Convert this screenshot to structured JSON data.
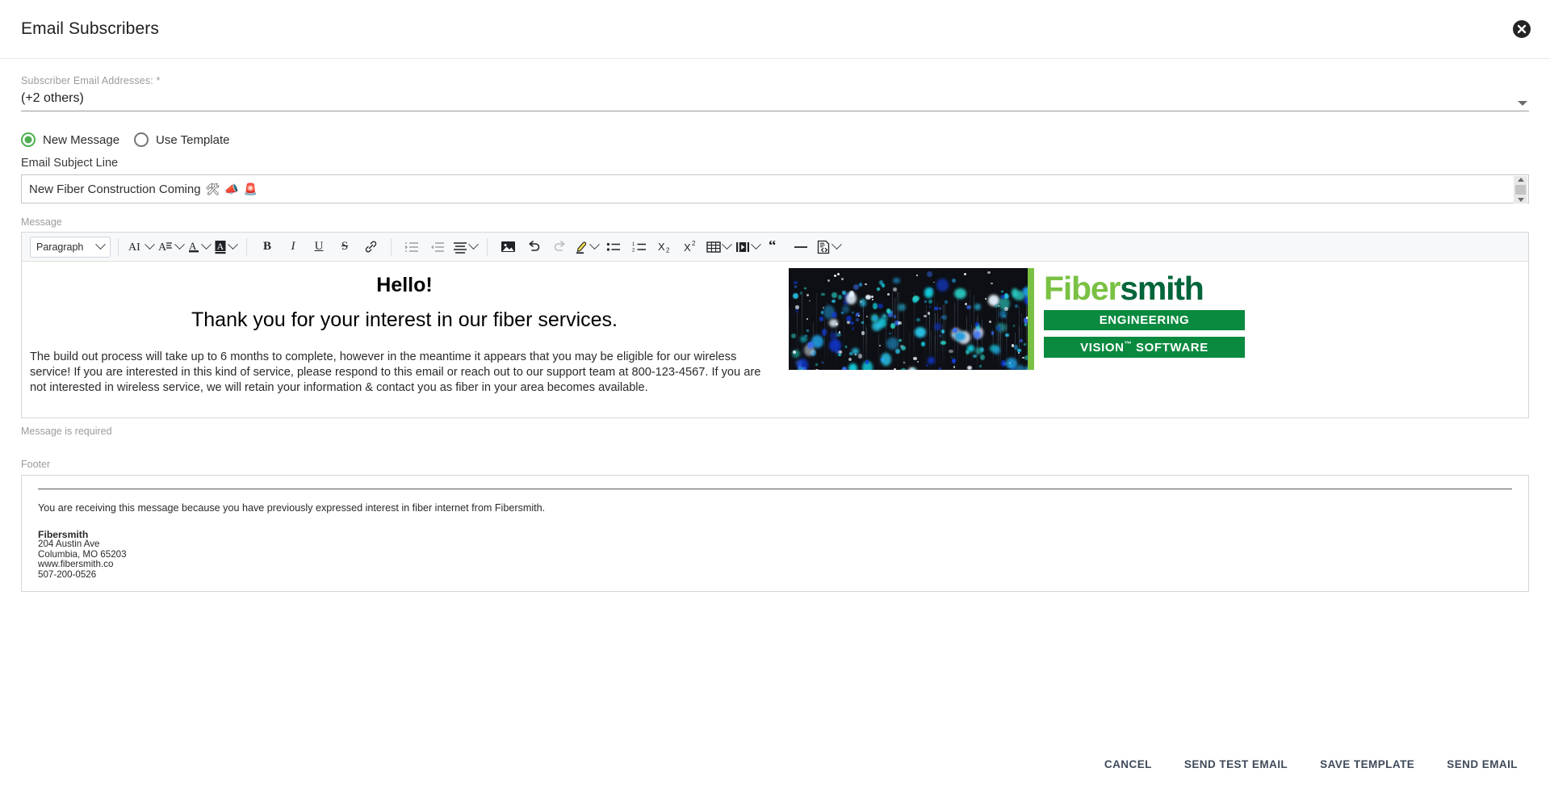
{
  "dialog": {
    "title": "Email Subscribers",
    "close_icon": "close-circle-icon"
  },
  "subscribers": {
    "label": "Subscriber Email Addresses: *",
    "value": "(+2 others)",
    "dropdown_icon": "chevron-down-icon"
  },
  "mode": {
    "options": [
      {
        "label": "New Message",
        "selected": true
      },
      {
        "label": "Use Template",
        "selected": false
      }
    ]
  },
  "subject": {
    "label": "Email Subject Line",
    "value": "New Fiber Construction Coming",
    "emojis": [
      "🛠",
      "📣",
      "🚨"
    ]
  },
  "message": {
    "label": "Message",
    "error": "Message is required",
    "toolbar": {
      "block_format": "Paragraph",
      "items": [
        {
          "name": "font-family-icon",
          "glyph": "AI",
          "caret": true
        },
        {
          "name": "font-size-icon",
          "glyph": "A≡",
          "caret": true
        },
        {
          "name": "text-color-icon",
          "glyph": "A",
          "caret": true
        },
        {
          "name": "background-color-icon",
          "glyph": "A",
          "caret": true
        },
        {
          "name": "bold-icon",
          "glyph": "B",
          "caret": false
        },
        {
          "name": "italic-icon",
          "glyph": "I",
          "caret": false
        },
        {
          "name": "underline-icon",
          "glyph": "U",
          "caret": false
        },
        {
          "name": "strikethrough-icon",
          "glyph": "S",
          "caret": false
        },
        {
          "name": "link-icon",
          "glyph": "🔗",
          "caret": false
        },
        {
          "name": "indent-increase-icon",
          "glyph": "",
          "caret": false
        },
        {
          "name": "indent-decrease-icon",
          "glyph": "",
          "caret": false
        },
        {
          "name": "align-icon",
          "glyph": "",
          "caret": true
        },
        {
          "name": "insert-image-icon",
          "glyph": "",
          "caret": false
        },
        {
          "name": "undo-icon",
          "glyph": "↶",
          "caret": false
        },
        {
          "name": "redo-icon",
          "glyph": "↷",
          "caret": false
        },
        {
          "name": "highlight-icon",
          "glyph": "",
          "caret": true
        },
        {
          "name": "bullet-list-icon",
          "glyph": "",
          "caret": false
        },
        {
          "name": "numbered-list-icon",
          "glyph": "",
          "caret": false
        },
        {
          "name": "subscript-icon",
          "glyph": "X₂",
          "caret": false
        },
        {
          "name": "superscript-icon",
          "glyph": "X²",
          "caret": false
        },
        {
          "name": "insert-table-icon",
          "glyph": "",
          "caret": true
        },
        {
          "name": "insert-video-icon",
          "glyph": "",
          "caret": true
        },
        {
          "name": "blockquote-icon",
          "glyph": "“",
          "caret": false
        },
        {
          "name": "horizontal-rule-icon",
          "glyph": "—",
          "caret": false
        },
        {
          "name": "source-code-icon",
          "glyph": "",
          "caret": true
        }
      ]
    },
    "body": {
      "heading": "Hello!",
      "subheading": "Thank you for your interest in our fiber services.",
      "paragraph": "The build out process will take up to 6 months to complete, however in the meantime it appears that you may be eligible for our wireless service! If you are interested in this kind of service, please respond to this email or reach out to our support team at 800-123-4567. If you are not interested in wireless service, we will retain your information & contact you as fiber in your area becomes available."
    },
    "banner": {
      "photo_alt": "fiber-optic-strands-photo",
      "logo_part1": "Fiber",
      "logo_part2": "smith",
      "band1": "ENGINEERING",
      "band2_pre": "VISION",
      "band2_tm": "™",
      "band2_post": " SOFTWARE",
      "accent_green": "#7ac143",
      "dark_green": "#00653a",
      "band_green": "#0a8a3f"
    }
  },
  "footer": {
    "label": "Footer",
    "disclaimer": "You are receiving this message because you have previously expressed interest in fiber internet from Fibersmith.",
    "company": "Fibersmith",
    "address1": "204 Austin Ave",
    "address2": "Columbia, MO 65203",
    "website": "www.fibersmith.co",
    "phone": "507-200-0526"
  },
  "actions": {
    "cancel": "CANCEL",
    "send_test": "SEND TEST EMAIL",
    "save_template": "SAVE TEMPLATE",
    "send": "SEND EMAIL"
  }
}
